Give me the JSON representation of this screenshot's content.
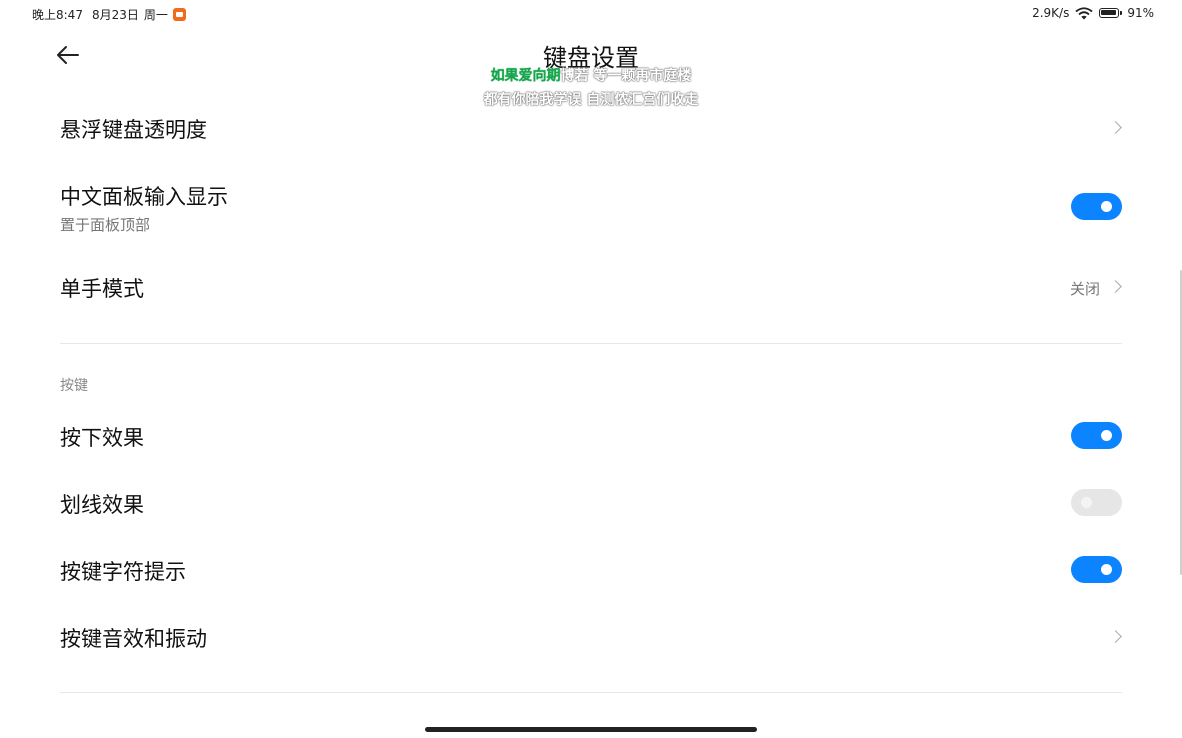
{
  "status_bar": {
    "time": "晚上8:47",
    "date": "8月23日",
    "weekday": "周一",
    "network_speed": "2.9K/s",
    "battery": "91%"
  },
  "header": {
    "title": "键盘设置",
    "lyrics_line1_highlight": "如果爱向期",
    "lyrics_line1_rest": "博若 等一颗再市庭楼",
    "lyrics_line2": "都有你陪我学误 自测侬汇宫们收走"
  },
  "settings": {
    "floating_opacity": {
      "label": "悬浮键盘透明度"
    },
    "cn_panel_display": {
      "label": "中文面板输入显示",
      "subtitle": "置于面板顶部",
      "enabled": true
    },
    "one_hand_mode": {
      "label": "单手模式",
      "value": "关闭"
    },
    "keys_section": {
      "header": "按键"
    },
    "press_effect": {
      "label": "按下效果",
      "enabled": true
    },
    "swipe_effect": {
      "label": "划线效果",
      "enabled": false
    },
    "key_char_hint": {
      "label": "按键字符提示",
      "enabled": true
    },
    "key_sound_vibration": {
      "label": "按键音效和振动"
    }
  },
  "colors": {
    "toggle_on": "#0d84ff",
    "toggle_off": "#e6e6e6",
    "lyrics_highlight": "#1aa34a",
    "recording_indicator": "#f26a1b"
  }
}
